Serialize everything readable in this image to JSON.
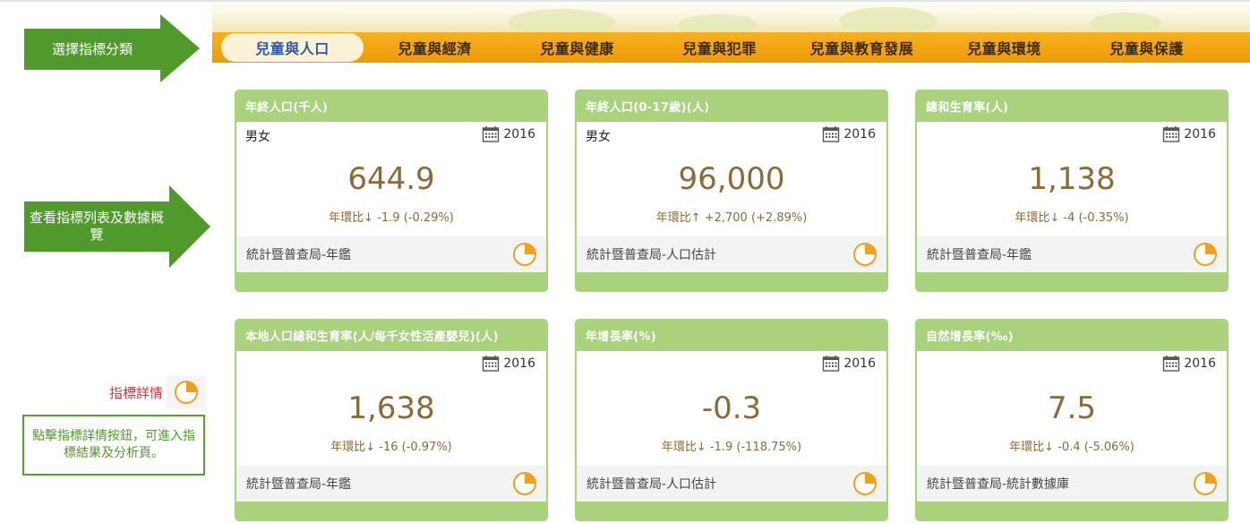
{
  "guide": {
    "arrow_categories": "選擇指標分類",
    "arrow_list": "查看指標列表及數據概覽",
    "detail_label": "指標詳情",
    "tip": "點擊指標詳情按鈕，可進入指標結果及分析頁。"
  },
  "tabs": [
    {
      "label": "兒童與人口",
      "active": true
    },
    {
      "label": "兒童與經濟",
      "active": false
    },
    {
      "label": "兒童與健康",
      "active": false
    },
    {
      "label": "兒童與犯罪",
      "active": false
    },
    {
      "label": "兒童與教育發展",
      "active": false
    },
    {
      "label": "兒童與環境",
      "active": false
    },
    {
      "label": "兒童與保護",
      "active": false
    }
  ],
  "cards": [
    {
      "title": "年終人口(千人)",
      "subtitle": "男女",
      "year": "2016",
      "value": "644.9",
      "change": "年環比↓ -1.9 (-0.29%)",
      "source": "統計暨普查局-年鑑"
    },
    {
      "title": "年終人口(0-17歲)(人)",
      "subtitle": "男女",
      "year": "2016",
      "value": "96,000",
      "change": "年環比↑ +2,700 (+2.89%)",
      "source": "統計暨普查局-人口估計"
    },
    {
      "title": "總和生育率(人)",
      "subtitle": "",
      "year": "2016",
      "value": "1,138",
      "change": "年環比↓ -4 (-0.35%)",
      "source": "統計暨普查局-年鑑"
    },
    {
      "title": "本地人口總和生育率(人/每千女性活產嬰兒)(人)",
      "subtitle": "",
      "year": "2016",
      "value": "1,638",
      "change": "年環比↓ -16 (-0.97%)",
      "source": "統計暨普查局-年鑑"
    },
    {
      "title": "年增長率(%)",
      "subtitle": "",
      "year": "2016",
      "value": "-0.3",
      "change": "年環比↓ -1.9 (-118.75%)",
      "source": "統計暨普查局-人口估計"
    },
    {
      "title": "自然增長率(‰)",
      "subtitle": "",
      "year": "2016",
      "value": "7.5",
      "change": "年環比↓ -0.4 (-5.06%)",
      "source": "統計暨普查局-統計數據庫"
    }
  ],
  "colors": {
    "arrow_green": "#4f9a2a",
    "card_green": "#a8d27c",
    "tab_orange": "#ef9a06",
    "value_brown": "#8c6a35",
    "detail_red": "#c03838",
    "active_tab_text": "#2d58a8"
  }
}
